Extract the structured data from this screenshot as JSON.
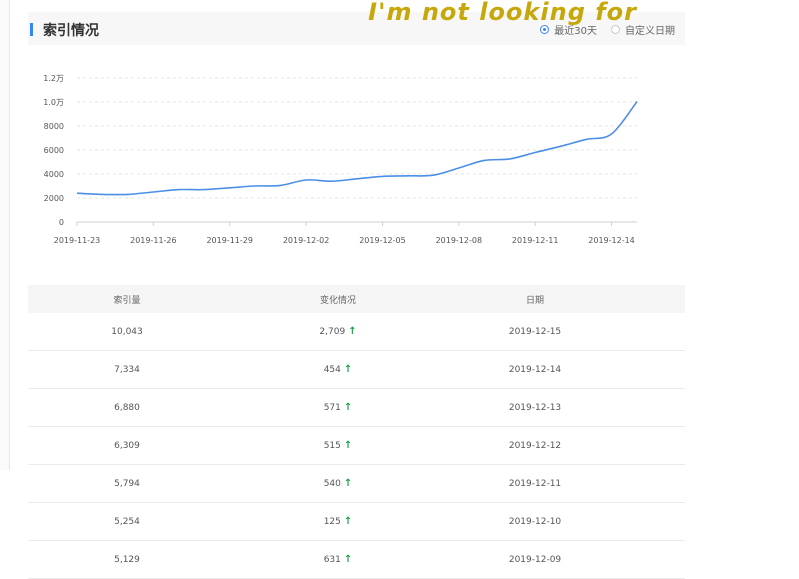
{
  "watermark": "I'm not looking for",
  "section": {
    "title": "索引情况",
    "filters": [
      {
        "label": "最近30天",
        "selected": true
      },
      {
        "label": "自定义日期",
        "selected": false
      }
    ]
  },
  "colors": {
    "accent": "#3884f4",
    "line": "#4b8fe6",
    "up_arrow": "#1aa34a"
  },
  "chart_data": {
    "type": "line",
    "x": [
      "2019-11-23",
      "2019-11-24",
      "2019-11-25",
      "2019-11-26",
      "2019-11-27",
      "2019-11-28",
      "2019-11-29",
      "2019-11-30",
      "2019-12-01",
      "2019-12-02",
      "2019-12-03",
      "2019-12-04",
      "2019-12-05",
      "2019-12-06",
      "2019-12-07",
      "2019-12-08",
      "2019-12-09",
      "2019-12-10",
      "2019-12-11",
      "2019-12-12",
      "2019-12-13",
      "2019-12-14",
      "2019-12-15"
    ],
    "x_tick_labels": [
      "2019-11-23",
      "2019-11-26",
      "2019-11-29",
      "2019-12-02",
      "2019-12-05",
      "2019-12-08",
      "2019-12-11",
      "2019-12-14"
    ],
    "values": [
      2400,
      2300,
      2300,
      2500,
      2700,
      2700,
      2850,
      3000,
      3050,
      3500,
      3400,
      3600,
      3800,
      3850,
      3900,
      4500,
      5129,
      5254,
      5794,
      6309,
      6880,
      7334,
      10043
    ],
    "y_tick_labels": [
      "0",
      "2000",
      "4000",
      "6000",
      "8000",
      "1.0万",
      "1.2万"
    ],
    "ylim": [
      0,
      12000
    ],
    "grid": true
  },
  "table": {
    "headers": [
      "索引量",
      "变化情况",
      "日期"
    ],
    "rows": [
      {
        "count": "10,043",
        "change": "2,709",
        "date": "2019-12-15"
      },
      {
        "count": "7,334",
        "change": "454",
        "date": "2019-12-14"
      },
      {
        "count": "6,880",
        "change": "571",
        "date": "2019-12-13"
      },
      {
        "count": "6,309",
        "change": "515",
        "date": "2019-12-12"
      },
      {
        "count": "5,794",
        "change": "540",
        "date": "2019-12-11"
      },
      {
        "count": "5,254",
        "change": "125",
        "date": "2019-12-10"
      },
      {
        "count": "5,129",
        "change": "631",
        "date": "2019-12-09"
      }
    ],
    "arrow_glyph": "↑"
  }
}
